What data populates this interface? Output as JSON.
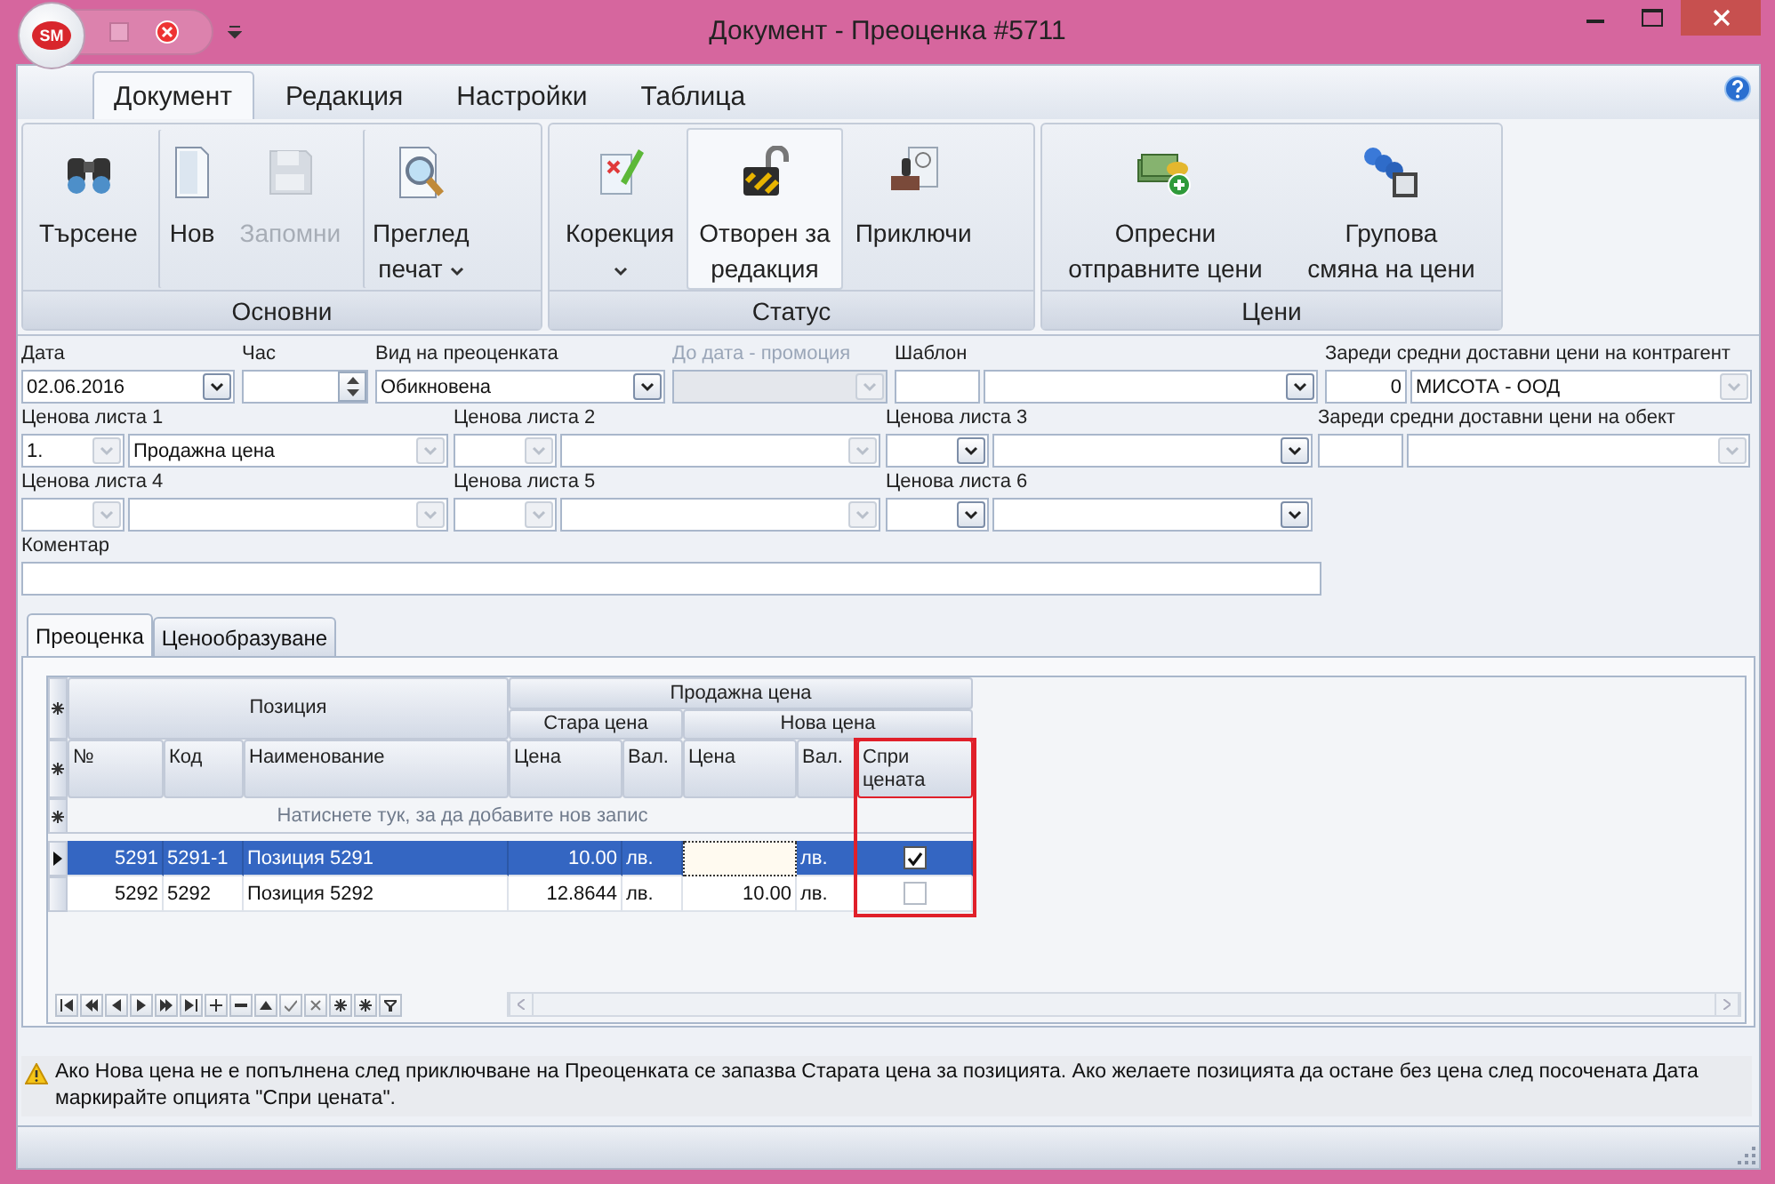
{
  "window": {
    "title": "Документ - Преоценка #5711",
    "logo": "SM"
  },
  "ribbon": {
    "tabs": [
      {
        "label": "Документ",
        "selected": true
      },
      {
        "label": "Редакция",
        "selected": false
      },
      {
        "label": "Настройки",
        "selected": false
      },
      {
        "label": "Таблица",
        "selected": false
      }
    ],
    "groups": [
      {
        "label": "Основни",
        "buttons": [
          {
            "lines": [
              "Търсене"
            ],
            "disabled": false,
            "dropdown": false,
            "pressed": false,
            "separator_before": false
          },
          {
            "lines": [
              "Нов"
            ],
            "disabled": false,
            "dropdown": false,
            "pressed": false,
            "separator_before": true
          },
          {
            "lines": [
              "Запомни"
            ],
            "disabled": true,
            "dropdown": false,
            "pressed": false,
            "separator_before": false
          },
          {
            "lines": [
              "Преглед",
              "печат"
            ],
            "disabled": false,
            "dropdown": true,
            "pressed": false,
            "separator_before": true
          }
        ]
      },
      {
        "label": "Статус",
        "buttons": [
          {
            "lines": [
              "Корекция"
            ],
            "disabled": false,
            "dropdown": true,
            "pressed": false,
            "separator_before": false
          },
          {
            "lines": [
              "Отворен за",
              "редакция"
            ],
            "disabled": false,
            "dropdown": false,
            "pressed": true,
            "separator_before": false
          },
          {
            "lines": [
              "Приключи"
            ],
            "disabled": false,
            "dropdown": false,
            "pressed": false,
            "separator_before": false
          }
        ]
      },
      {
        "label": "Цени",
        "buttons": [
          {
            "lines": [
              "Опресни",
              "отправните цени"
            ],
            "disabled": false,
            "dropdown": false,
            "pressed": false,
            "separator_before": false
          },
          {
            "lines": [
              "Групова",
              "смяна на цени"
            ],
            "disabled": false,
            "dropdown": false,
            "pressed": false,
            "separator_before": false
          }
        ]
      }
    ]
  },
  "form": {
    "header_fields": [
      {
        "label": "Дата",
        "disabled": false,
        "parts": [
          {
            "kind": "combo",
            "value": "02.06.2016",
            "active": true
          }
        ]
      },
      {
        "label": "Час",
        "disabled": false,
        "parts": [
          {
            "kind": "spin"
          }
        ]
      },
      {
        "label": "Вид на преоценката",
        "disabled": false,
        "parts": [
          {
            "kind": "combo",
            "value": "Обикновена",
            "active": true
          }
        ]
      },
      {
        "label": "До дата - промоция",
        "disabled": true,
        "parts": [
          {
            "kind": "combo",
            "active": false
          }
        ]
      },
      {
        "label": "Шаблон",
        "disabled": false,
        "parts": [
          {
            "kind": "text"
          },
          {
            "kind": "combo",
            "active": true
          }
        ]
      },
      {
        "label": "Зареди средни доставни цени на контрагент",
        "disabled": false,
        "parts": [
          {
            "kind": "number",
            "value": "0"
          },
          {
            "kind": "combo",
            "value": "МИСОТА - ООД",
            "active": false
          }
        ]
      }
    ],
    "price_lists": [
      {
        "label": "Ценова листа 1",
        "disabled": false,
        "parts": [
          {
            "kind": "combo",
            "value": "1.",
            "active": false
          },
          {
            "kind": "combo",
            "value": "Продажна цена",
            "active": false
          }
        ]
      },
      {
        "label": "Ценова листа 2",
        "disabled": false,
        "parts": [
          {
            "kind": "combo",
            "active": false
          },
          {
            "kind": "combo",
            "active": false
          }
        ]
      },
      {
        "label": "Ценова листа 3",
        "disabled": false,
        "parts": [
          {
            "kind": "combo",
            "active": true
          },
          {
            "kind": "combo",
            "active": true
          }
        ]
      },
      {
        "label": "Ценова листа 4",
        "disabled": false,
        "parts": [
          {
            "kind": "combo",
            "active": false
          },
          {
            "kind": "combo",
            "active": false
          }
        ]
      },
      {
        "label": "Ценова листа 5",
        "disabled": false,
        "parts": [
          {
            "kind": "combo",
            "active": false
          },
          {
            "kind": "combo",
            "active": false
          }
        ]
      },
      {
        "label": "Ценова листа 6",
        "disabled": false,
        "parts": [
          {
            "kind": "combo",
            "active": true
          },
          {
            "kind": "combo",
            "active": true
          }
        ]
      }
    ],
    "object_loader": {
      "label": "Зареди средни доставни цени на обект",
      "disabled": false,
      "parts": [
        {
          "kind": "text"
        },
        {
          "kind": "combo",
          "active": false
        }
      ]
    },
    "comment": {
      "label": "Коментар"
    }
  },
  "tabs": [
    {
      "label": "Преоценка",
      "selected": true
    },
    {
      "label": "Ценообразуване",
      "selected": false
    }
  ],
  "grid": {
    "bands": [
      {
        "label": "Позиция"
      },
      {
        "label": "Продажна цена",
        "children": [
          {
            "label": "Стара цена"
          },
          {
            "label": "Нова цена"
          }
        ]
      }
    ],
    "columns": [
      {
        "label": "№",
        "highlighted": false
      },
      {
        "label": "Код",
        "highlighted": false
      },
      {
        "label": "Наименование",
        "highlighted": false
      },
      {
        "label": "Цена",
        "highlighted": false
      },
      {
        "label": "Вал.",
        "highlighted": false
      },
      {
        "label": "Цена",
        "highlighted": false
      },
      {
        "label": "Вал.",
        "highlighted": false
      },
      {
        "label": "Спри цената",
        "highlighted": true
      }
    ],
    "new_row_hint": "Натиснете тук, за да добавите нов запис",
    "rows": [
      {
        "number": "5291",
        "code": "5291-1",
        "name": "Позиция 5291",
        "old_price": "10.00",
        "old_currency": "лв.",
        "new_currency": "лв.",
        "stop_price": true,
        "selected": true,
        "editing": true
      },
      {
        "number": "5292",
        "code": "5292",
        "name": "Позиция 5292",
        "old_price": "12.8644",
        "old_currency": "лв.",
        "new_price": "10.00",
        "new_currency": "лв.",
        "stop_price": false,
        "selected": false,
        "editing": false
      }
    ]
  },
  "warning": "Ако Нова цена не е попълнена след приключване на Преоценката се запазва Старата цена за позицията. Ако желаете позицията да остане без цена след посочената Дата маркирайте опцията \"Спри цената\"."
}
